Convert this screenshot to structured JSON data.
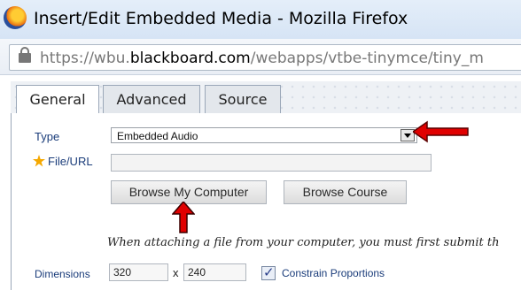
{
  "window": {
    "title": "Insert/Edit Embedded Media - Mozilla Firefox",
    "url_prefix": "https://wbu.",
    "url_domain": "blackboard.com",
    "url_path": "/webapps/vtbe-tinymce/tiny_m"
  },
  "tabs": [
    {
      "label": "General",
      "active": true
    },
    {
      "label": "Advanced",
      "active": false
    },
    {
      "label": "Source",
      "active": false
    }
  ],
  "form": {
    "type_label": "Type",
    "type_value": "Embedded Audio",
    "file_label": "File/URL",
    "file_value": "",
    "browse_computer_label": "Browse My Computer",
    "browse_course_label": "Browse Course",
    "note": "When attaching a file from your computer, you must first submit th",
    "dimensions_label": "Dimensions",
    "width_value": "320",
    "dimension_separator": "x",
    "height_value": "240",
    "constrain_label": "Constrain Proportions",
    "constrain_checked": true
  },
  "colors": {
    "annotation_arrow": "#e00000",
    "label_text": "#1a3c7a",
    "required_star": "#f5a800"
  },
  "icons": [
    "firefox-icon",
    "lock-icon",
    "required-star-icon",
    "dropdown-arrow-icon",
    "checkbox-check-icon",
    "annotation-arrow-icon"
  ]
}
